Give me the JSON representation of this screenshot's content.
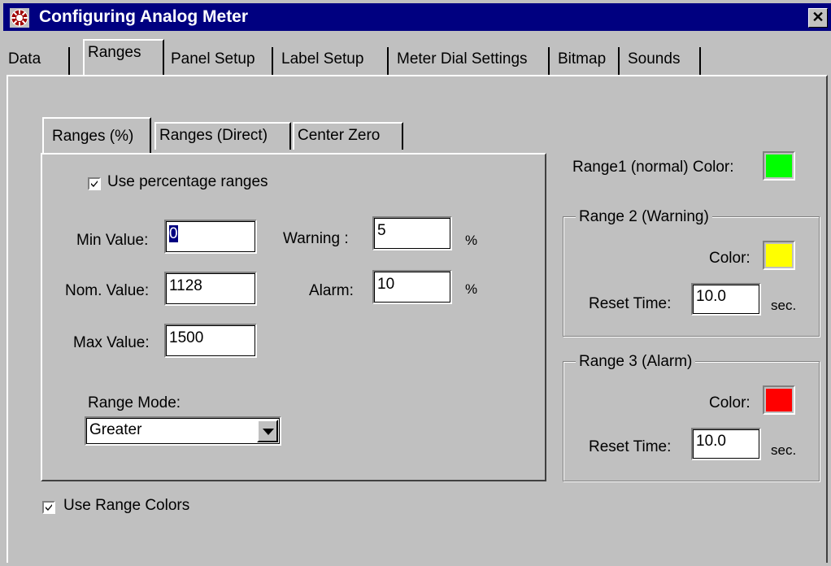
{
  "window": {
    "title": "Configuring Analog Meter",
    "close_glyph": "✕"
  },
  "main_tabs": [
    {
      "label": "Data"
    },
    {
      "label": "Ranges"
    },
    {
      "label": "Panel Setup"
    },
    {
      "label": "Label Setup"
    },
    {
      "label": "Meter Dial Settings"
    },
    {
      "label": "Bitmap"
    },
    {
      "label": "Sounds"
    }
  ],
  "sub_tabs": [
    {
      "label": "Ranges (%)"
    },
    {
      "label": "Ranges (Direct)"
    },
    {
      "label": "Center Zero"
    }
  ],
  "ranges_pct": {
    "use_percentage_label": "Use percentage ranges",
    "use_percentage_checked": true,
    "min_label": "Min Value:",
    "min_value": "0",
    "nom_label": "Nom. Value:",
    "nom_value": "1128",
    "max_label": "Max Value:",
    "max_value": "1500",
    "warning_label": "Warning :",
    "warning_value": "5",
    "warning_unit": "%",
    "alarm_label": "Alarm:",
    "alarm_value": "10",
    "alarm_unit": "%",
    "range_mode_label": "Range Mode:",
    "range_mode_value": "Greater"
  },
  "use_range_colors_label": "Use Range Colors",
  "use_range_colors_checked": true,
  "range1": {
    "label": "Range1 (normal) Color:",
    "color": "#00ff00"
  },
  "range2": {
    "title": "Range 2 (Warning)",
    "color_label": "Color:",
    "color": "#ffff00",
    "reset_label": "Reset Time:",
    "reset_value": "10.0",
    "unit": "sec."
  },
  "range3": {
    "title": "Range 3 (Alarm)",
    "color_label": "Color:",
    "color": "#ff0000",
    "reset_label": "Reset Time:",
    "reset_value": "10.0",
    "unit": "sec."
  }
}
